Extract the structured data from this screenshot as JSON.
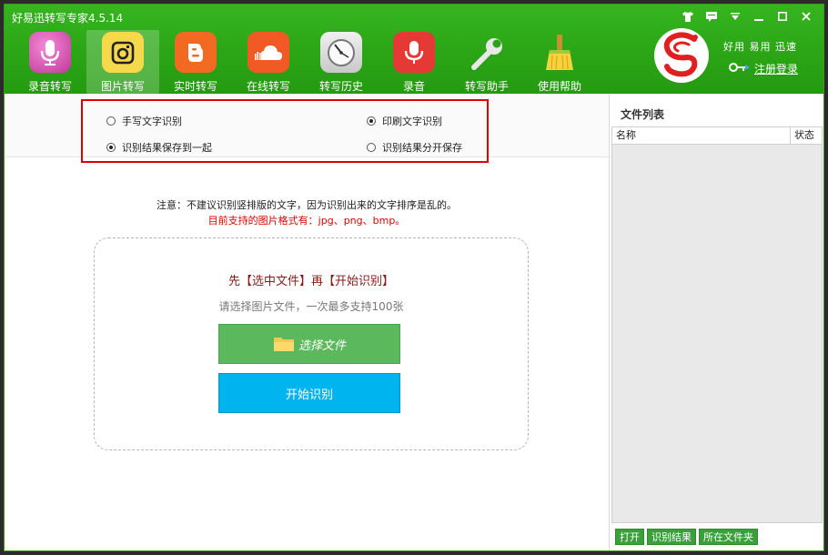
{
  "app": {
    "title": "好易迅转写专家4.5.14",
    "slogan": "好用 易用 迅速",
    "register_label": "注册登录"
  },
  "window_controls": [
    "shirt-icon",
    "message-icon",
    "dropdown-icon",
    "minimize-icon",
    "maximize-icon",
    "close-icon"
  ],
  "toolbar": {
    "items": [
      {
        "label": "录音转写",
        "icon": "microphone-icon",
        "active": false
      },
      {
        "label": "图片转写",
        "icon": "camera-icon",
        "active": true
      },
      {
        "label": "实时转写",
        "icon": "blogger-icon",
        "active": false
      },
      {
        "label": "在线转写",
        "icon": "cloud-icon",
        "active": false
      },
      {
        "label": "转写历史",
        "icon": "clock-icon",
        "active": false
      },
      {
        "label": "录音",
        "icon": "mic-record-icon",
        "active": false
      },
      {
        "label": "转写助手",
        "icon": "wrench-icon",
        "active": false
      },
      {
        "label": "使用帮助",
        "icon": "broom-icon",
        "active": false
      }
    ]
  },
  "options": {
    "handwriting": {
      "label": "手写文字识别",
      "checked": false
    },
    "printed": {
      "label": "印刷文字识别",
      "checked": true
    },
    "save_together": {
      "label": "识别结果保存到一起",
      "checked": true
    },
    "save_separately": {
      "label": "识别结果分开保存",
      "checked": false
    }
  },
  "main": {
    "notice": "注意：不建议识别竖排版的文字，因为识别出来的文字排序是乱的。",
    "formats": "目前支持的图片格式有：jpg、png、bmp。",
    "step_text": "先【选中文件】再【开始识别】",
    "limit_text": "请选择图片文件，一次最多支持100张",
    "select_button": "选择文件",
    "start_button": "开始识别"
  },
  "sidebar": {
    "title": "文件列表",
    "columns": [
      "名称",
      "状态"
    ],
    "buttons": [
      "打开",
      "识别结果",
      "所在文件夹"
    ]
  },
  "colors": {
    "brand_green": "#2aa415",
    "select_green": "#5cb85c",
    "start_blue": "#00b4f0",
    "highlight_red": "#e00000"
  }
}
